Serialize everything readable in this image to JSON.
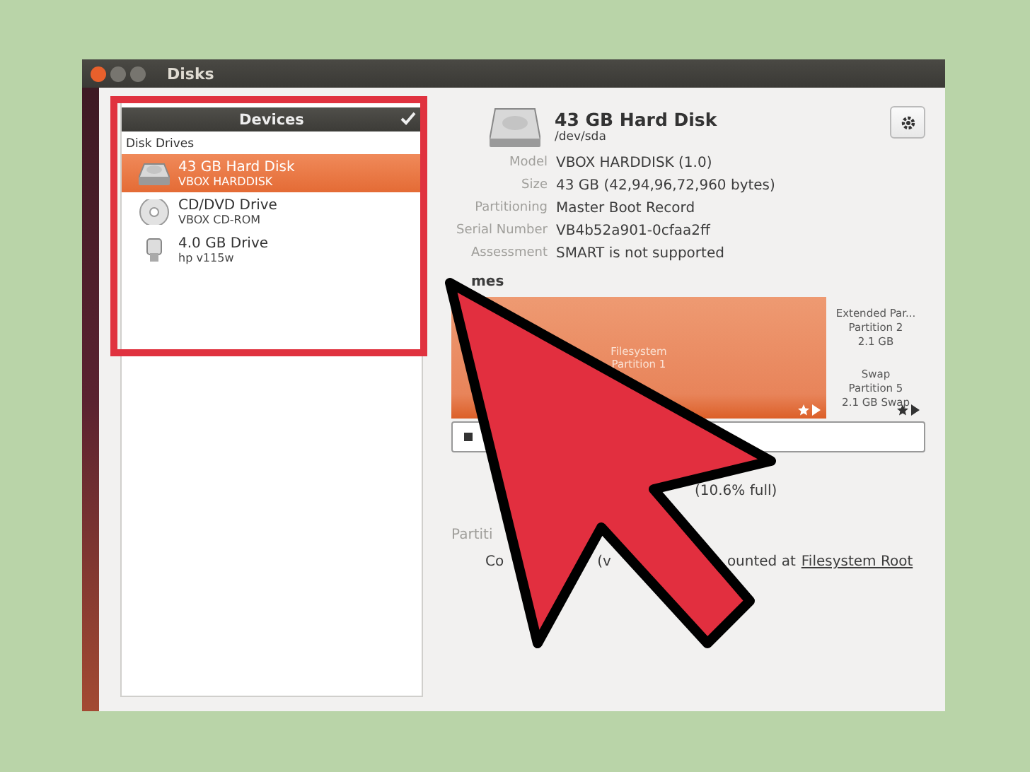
{
  "window": {
    "title": "Disks"
  },
  "devices": {
    "title": "Devices",
    "section": "Disk Drives",
    "items": [
      {
        "kind": "hdd",
        "name": "43 GB Hard Disk",
        "model": "VBOX HARDDISK",
        "selected": true
      },
      {
        "kind": "optical",
        "name": "CD/DVD Drive",
        "model": "VBOX CD-ROM",
        "selected": false
      },
      {
        "kind": "usb",
        "name": "4.0 GB Drive",
        "model": "hp v115w",
        "selected": false
      }
    ]
  },
  "disk": {
    "title": "43 GB Hard Disk",
    "path": "/dev/sda",
    "properties": [
      {
        "label": "Model",
        "value": "VBOX HARDDISK (1.0)"
      },
      {
        "label": "Size",
        "value": "43 GB (42,94,96,72,960 bytes)"
      },
      {
        "label": "Partitioning",
        "value": "Master Boot Record"
      },
      {
        "label": "Serial Number",
        "value": "VB4b52a901-0cfaa2ff"
      },
      {
        "label": "Assessment",
        "value": "SMART is not supported"
      }
    ]
  },
  "volumes": {
    "heading": "mes",
    "main_segment": {
      "lines": [
        "Filesystem",
        "Partition 1"
      ],
      "selected": true
    },
    "side_segments": [
      {
        "lines": [
          "Extended Par...",
          "Partition 2",
          "2.1 GB"
        ],
        "selected": false
      },
      {
        "lines": [
          "Swap",
          "Partition 5",
          "2.1 GB Swap"
        ],
        "selected": false
      }
    ],
    "usage": "(10.6% full)",
    "partition_label": "Partiti",
    "contents_label": "Co",
    "contents_fragment": "(v",
    "mounted_text": "ounted at",
    "mount_link": "Filesystem Root"
  }
}
